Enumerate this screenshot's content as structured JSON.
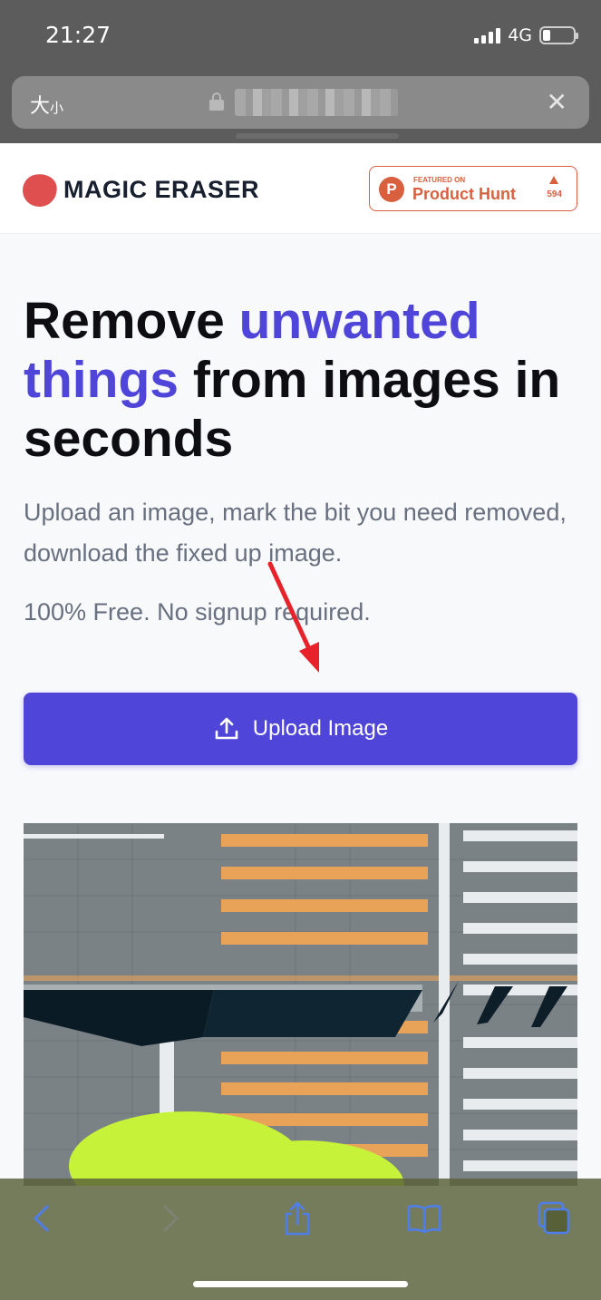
{
  "status_bar": {
    "time": "21:27",
    "network": "4G"
  },
  "url_bar": {
    "text_size_label": "大",
    "text_size_small": "小",
    "close_symbol": "✕"
  },
  "header": {
    "brand": "MAGIC ERASER",
    "brand_color": "#e04f4f",
    "product_hunt": {
      "featured_label": "FEATURED ON",
      "name": "Product Hunt",
      "upvotes": "594",
      "logo_letter": "P",
      "color": "#d8603f"
    }
  },
  "hero": {
    "title_part1": "Remove ",
    "title_accent": "unwanted things",
    "title_part2": " from images in seconds",
    "accent_color": "#4f45d9",
    "subtitle": "Upload an image, mark the bit you need removed, download the fixed up image.",
    "free_note": "100% Free. No signup required."
  },
  "upload_button": {
    "label": "Upload Image",
    "icon": "upload-icon",
    "color": "#4f46d9"
  },
  "annotation": {
    "type": "arrow",
    "color": "#e8222a"
  },
  "demo_image": {
    "description_icon": "street-crosswalk-photo"
  },
  "toolbar": {
    "icons": [
      "back-icon",
      "forward-icon",
      "share-icon",
      "bookmarks-icon",
      "tabs-icon"
    ],
    "icon_color": "#4f7ee8"
  }
}
